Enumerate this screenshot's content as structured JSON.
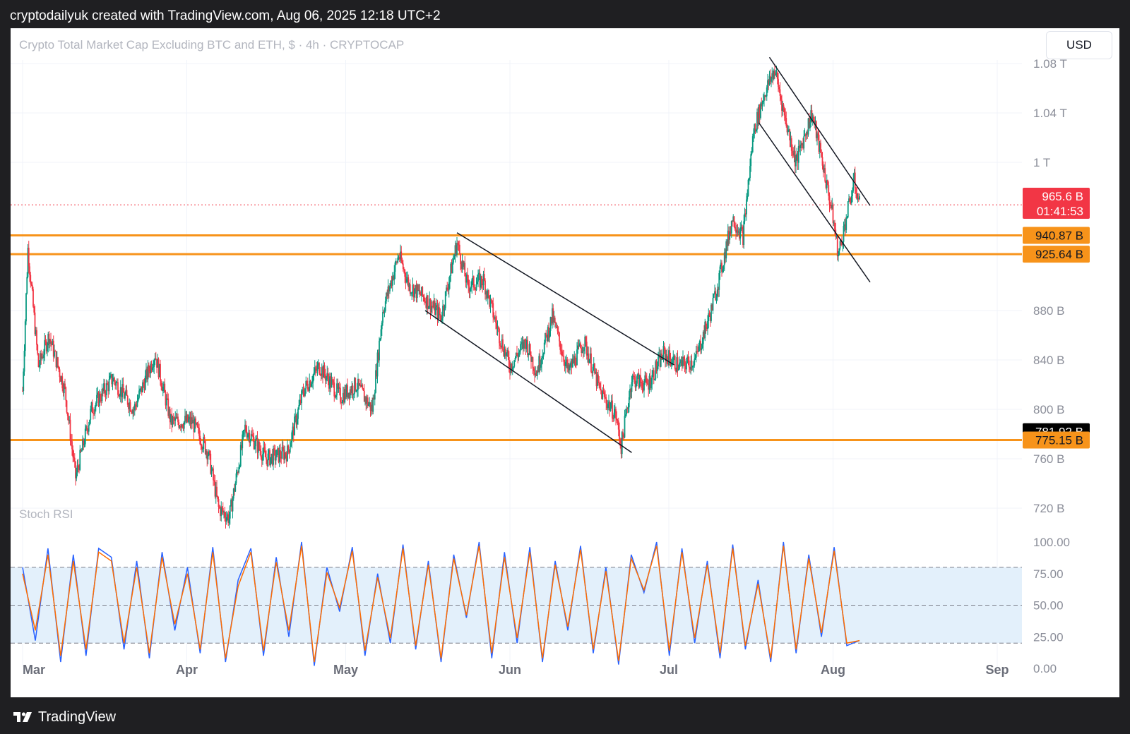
{
  "header": {
    "attribution": "cryptodailyuk created with TradingView.com, Aug 06, 2025 12:18 UTC+2"
  },
  "chart": {
    "title": "Crypto Total Market Cap Excluding BTC and ETH, $ · 4h · CRYPTOCAP",
    "currency_button": "USD",
    "indicator_label": "Stoch RSI"
  },
  "footer": {
    "brand": "TradingView"
  },
  "colors": {
    "up": "#089981",
    "down": "#f23645",
    "support": "#f7931a",
    "price_badge": "#f23645",
    "k_line": "#2962ff",
    "d_line": "#ff6d00",
    "band_fill": "#e3f0fb"
  },
  "chart_data": [
    {
      "type": "candlestick",
      "title": "Crypto Total Market Cap Excluding BTC and ETH, $ · 4h · CRYPTOCAP",
      "x_ticks": [
        "Mar",
        "Apr",
        "May",
        "Jun",
        "Jul",
        "Aug",
        "Sep"
      ],
      "y_ticks": [
        "720 B",
        "760 B",
        "800 B",
        "840 B",
        "880 B",
        "1 T",
        "1.04 T",
        "1.08 T"
      ],
      "ylim": [
        710,
        1090
      ],
      "unit": "B",
      "series_close_path": [
        [
          "2025-03-01",
          815
        ],
        [
          "2025-03-02",
          930
        ],
        [
          "2025-03-04",
          835
        ],
        [
          "2025-03-06",
          860
        ],
        [
          "2025-03-09",
          815
        ],
        [
          "2025-03-11",
          745
        ],
        [
          "2025-03-14",
          800
        ],
        [
          "2025-03-18",
          825
        ],
        [
          "2025-03-22",
          800
        ],
        [
          "2025-03-26",
          845
        ],
        [
          "2025-03-29",
          790
        ],
        [
          "2025-04-02",
          790
        ],
        [
          "2025-04-05",
          765
        ],
        [
          "2025-04-07",
          720
        ],
        [
          "2025-04-09",
          712
        ],
        [
          "2025-04-12",
          785
        ],
        [
          "2025-04-16",
          760
        ],
        [
          "2025-04-20",
          765
        ],
        [
          "2025-04-23",
          815
        ],
        [
          "2025-04-26",
          835
        ],
        [
          "2025-04-30",
          810
        ],
        [
          "2025-05-03",
          820
        ],
        [
          "2025-05-06",
          800
        ],
        [
          "2025-05-08",
          880
        ],
        [
          "2025-05-11",
          925
        ],
        [
          "2025-05-13",
          900
        ],
        [
          "2025-05-16",
          890
        ],
        [
          "2025-05-19",
          875
        ],
        [
          "2025-05-22",
          935
        ],
        [
          "2025-05-24",
          900
        ],
        [
          "2025-05-27",
          905
        ],
        [
          "2025-05-30",
          860
        ],
        [
          "2025-06-01",
          835
        ],
        [
          "2025-06-04",
          855
        ],
        [
          "2025-06-06",
          830
        ],
        [
          "2025-06-09",
          875
        ],
        [
          "2025-06-12",
          830
        ],
        [
          "2025-06-15",
          855
        ],
        [
          "2025-06-18",
          815
        ],
        [
          "2025-06-21",
          795
        ],
        [
          "2025-06-22",
          770
        ],
        [
          "2025-06-24",
          825
        ],
        [
          "2025-06-27",
          820
        ],
        [
          "2025-06-30",
          845
        ],
        [
          "2025-07-03",
          835
        ],
        [
          "2025-07-06",
          840
        ],
        [
          "2025-07-09",
          880
        ],
        [
          "2025-07-11",
          915
        ],
        [
          "2025-07-13",
          955
        ],
        [
          "2025-07-15",
          940
        ],
        [
          "2025-07-17",
          1025
        ],
        [
          "2025-07-19",
          1055
        ],
        [
          "2025-07-21",
          1075
        ],
        [
          "2025-07-23",
          1035
        ],
        [
          "2025-07-25",
          1000
        ],
        [
          "2025-07-28",
          1040
        ],
        [
          "2025-07-30",
          1000
        ],
        [
          "2025-08-01",
          955
        ],
        [
          "2025-08-02",
          925
        ],
        [
          "2025-08-04",
          965
        ],
        [
          "2025-08-05",
          985
        ],
        [
          "2025-08-06",
          966
        ]
      ],
      "channel_1_upper": [
        [
          "2025-05-22",
          943
        ],
        [
          "2025-07-02",
          836
        ]
      ],
      "channel_1_lower": [
        [
          "2025-05-16",
          880
        ],
        [
          "2025-06-24",
          765
        ]
      ],
      "channel_2_upper": [
        [
          "2025-07-20",
          1085
        ],
        [
          "2025-08-08",
          965
        ]
      ],
      "channel_2_lower": [
        [
          "2025-07-18",
          1032
        ],
        [
          "2025-08-08",
          903
        ]
      ],
      "horizontal_levels": [
        {
          "value": 940.87,
          "label": "940.87 B"
        },
        {
          "value": 925.64,
          "label": "925.64 B"
        },
        {
          "value": 775.15,
          "label": "775.15 B"
        }
      ],
      "price_badge": {
        "value": 965.6,
        "label": "965.6 B",
        "countdown": "01:41:53"
      },
      "crosshair_badge": {
        "value": 781.92,
        "label": "781.92 B"
      }
    },
    {
      "type": "line",
      "title": "Stoch RSI",
      "y_ticks": [
        "0.00",
        "25.00",
        "50.00",
        "75.00",
        "100.00"
      ],
      "ylim": [
        0,
        100
      ],
      "bands": {
        "upper": 80,
        "middle": 50,
        "lower": 20
      },
      "series": [
        {
          "name": "K",
          "values": [
            80,
            22,
            95,
            5,
            90,
            10,
            95,
            88,
            15,
            85,
            8,
            92,
            30,
            80,
            12,
            96,
            5,
            70,
            95,
            10,
            88,
            25,
            100,
            2,
            80,
            45,
            96,
            10,
            75,
            20,
            98,
            15,
            85,
            5,
            90,
            40,
            100,
            8,
            92,
            20,
            96,
            5,
            85,
            30,
            97,
            12,
            80,
            3,
            90,
            60,
            100,
            10,
            95,
            20,
            85,
            8,
            98,
            15,
            70,
            5,
            100,
            12,
            90,
            25,
            96,
            18,
            22
          ]
        },
        {
          "name": "D",
          "values": [
            75,
            30,
            90,
            10,
            85,
            15,
            92,
            85,
            20,
            80,
            12,
            88,
            35,
            75,
            15,
            92,
            8,
            65,
            92,
            14,
            84,
            30,
            97,
            5,
            76,
            48,
            93,
            14,
            72,
            24,
            95,
            18,
            82,
            8,
            87,
            42,
            97,
            12,
            88,
            24,
            92,
            8,
            82,
            33,
            94,
            15,
            77,
            6,
            87,
            62,
            97,
            14,
            92,
            24,
            82,
            12,
            95,
            18,
            67,
            8,
            97,
            15,
            87,
            28,
            93,
            20,
            22
          ]
        }
      ]
    }
  ]
}
